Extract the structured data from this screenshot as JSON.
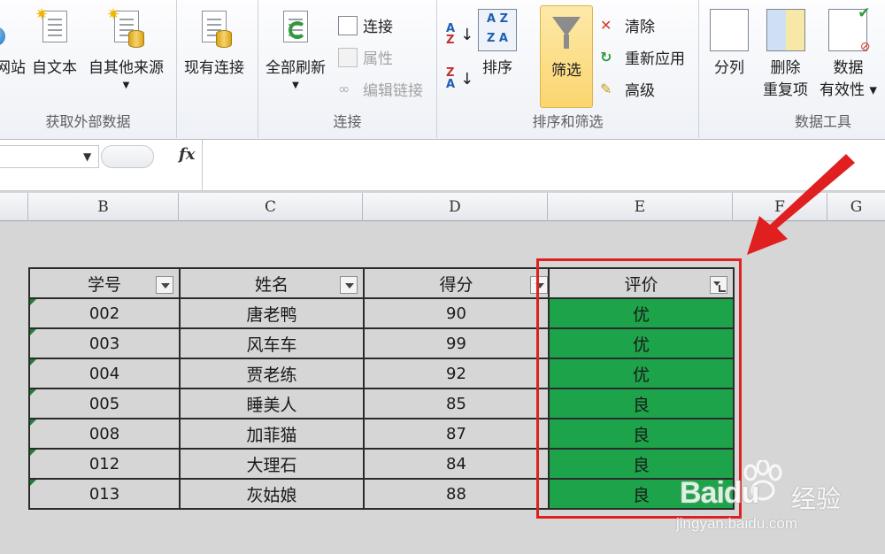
{
  "ribbon": {
    "groups": [
      {
        "label": "获取外部数据"
      },
      {
        "label": "连接"
      },
      {
        "label": "排序和筛选"
      },
      {
        "label": "数据工具"
      }
    ],
    "buttons": {
      "web": "网站",
      "text": "自文本",
      "other": "自其他来源",
      "existing": "现有连接",
      "refresh_all": "全部刷新",
      "connections": "连接",
      "properties": "属性",
      "edit_links": "编辑链接",
      "sort": "排序",
      "filter": "筛选",
      "clear": "清除",
      "reapply": "重新应用",
      "advanced": "高级",
      "split": "分列",
      "remove_dup_1": "删除",
      "remove_dup_2": "重复项",
      "validation_1": "数据",
      "validation_2": "有效性"
    },
    "accent_color": "#fbd670"
  },
  "formula_bar": {
    "fx_label": "fx",
    "value": ""
  },
  "columns": [
    "B",
    "C",
    "D",
    "E",
    "F",
    "G"
  ],
  "table": {
    "headers": [
      "学号",
      "姓名",
      "得分",
      "评价"
    ],
    "rows": [
      [
        "002",
        "唐老鸭",
        "90",
        "优"
      ],
      [
        "003",
        "风车车",
        "99",
        "优"
      ],
      [
        "004",
        "贾老练",
        "92",
        "优"
      ],
      [
        "005",
        "睡美人",
        "85",
        "良"
      ],
      [
        "008",
        "加菲猫",
        "87",
        "良"
      ],
      [
        "012",
        "大理石",
        "84",
        "良"
      ],
      [
        "013",
        "灰姑娘",
        "88",
        "良"
      ]
    ],
    "grade_fill": "#1da349",
    "filtered_column": "评价"
  },
  "annotation": {
    "color": "#e02020"
  },
  "watermark": {
    "brand": "Baidu",
    "cn": "经验",
    "url": "jingyan.baidu.com"
  }
}
